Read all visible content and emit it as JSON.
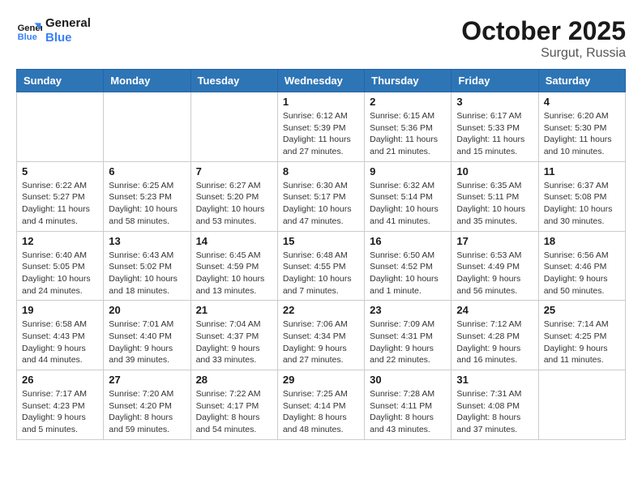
{
  "header": {
    "logo_general": "General",
    "logo_blue": "Blue",
    "month": "October 2025",
    "location": "Surgut, Russia"
  },
  "weekdays": [
    "Sunday",
    "Monday",
    "Tuesday",
    "Wednesday",
    "Thursday",
    "Friday",
    "Saturday"
  ],
  "weeks": [
    [
      {
        "day": "",
        "info": ""
      },
      {
        "day": "",
        "info": ""
      },
      {
        "day": "",
        "info": ""
      },
      {
        "day": "1",
        "info": "Sunrise: 6:12 AM\nSunset: 5:39 PM\nDaylight: 11 hours\nand 27 minutes."
      },
      {
        "day": "2",
        "info": "Sunrise: 6:15 AM\nSunset: 5:36 PM\nDaylight: 11 hours\nand 21 minutes."
      },
      {
        "day": "3",
        "info": "Sunrise: 6:17 AM\nSunset: 5:33 PM\nDaylight: 11 hours\nand 15 minutes."
      },
      {
        "day": "4",
        "info": "Sunrise: 6:20 AM\nSunset: 5:30 PM\nDaylight: 11 hours\nand 10 minutes."
      }
    ],
    [
      {
        "day": "5",
        "info": "Sunrise: 6:22 AM\nSunset: 5:27 PM\nDaylight: 11 hours\nand 4 minutes."
      },
      {
        "day": "6",
        "info": "Sunrise: 6:25 AM\nSunset: 5:23 PM\nDaylight: 10 hours\nand 58 minutes."
      },
      {
        "day": "7",
        "info": "Sunrise: 6:27 AM\nSunset: 5:20 PM\nDaylight: 10 hours\nand 53 minutes."
      },
      {
        "day": "8",
        "info": "Sunrise: 6:30 AM\nSunset: 5:17 PM\nDaylight: 10 hours\nand 47 minutes."
      },
      {
        "day": "9",
        "info": "Sunrise: 6:32 AM\nSunset: 5:14 PM\nDaylight: 10 hours\nand 41 minutes."
      },
      {
        "day": "10",
        "info": "Sunrise: 6:35 AM\nSunset: 5:11 PM\nDaylight: 10 hours\nand 35 minutes."
      },
      {
        "day": "11",
        "info": "Sunrise: 6:37 AM\nSunset: 5:08 PM\nDaylight: 10 hours\nand 30 minutes."
      }
    ],
    [
      {
        "day": "12",
        "info": "Sunrise: 6:40 AM\nSunset: 5:05 PM\nDaylight: 10 hours\nand 24 minutes."
      },
      {
        "day": "13",
        "info": "Sunrise: 6:43 AM\nSunset: 5:02 PM\nDaylight: 10 hours\nand 18 minutes."
      },
      {
        "day": "14",
        "info": "Sunrise: 6:45 AM\nSunset: 4:59 PM\nDaylight: 10 hours\nand 13 minutes."
      },
      {
        "day": "15",
        "info": "Sunrise: 6:48 AM\nSunset: 4:55 PM\nDaylight: 10 hours\nand 7 minutes."
      },
      {
        "day": "16",
        "info": "Sunrise: 6:50 AM\nSunset: 4:52 PM\nDaylight: 10 hours\nand 1 minute."
      },
      {
        "day": "17",
        "info": "Sunrise: 6:53 AM\nSunset: 4:49 PM\nDaylight: 9 hours\nand 56 minutes."
      },
      {
        "day": "18",
        "info": "Sunrise: 6:56 AM\nSunset: 4:46 PM\nDaylight: 9 hours\nand 50 minutes."
      }
    ],
    [
      {
        "day": "19",
        "info": "Sunrise: 6:58 AM\nSunset: 4:43 PM\nDaylight: 9 hours\nand 44 minutes."
      },
      {
        "day": "20",
        "info": "Sunrise: 7:01 AM\nSunset: 4:40 PM\nDaylight: 9 hours\nand 39 minutes."
      },
      {
        "day": "21",
        "info": "Sunrise: 7:04 AM\nSunset: 4:37 PM\nDaylight: 9 hours\nand 33 minutes."
      },
      {
        "day": "22",
        "info": "Sunrise: 7:06 AM\nSunset: 4:34 PM\nDaylight: 9 hours\nand 27 minutes."
      },
      {
        "day": "23",
        "info": "Sunrise: 7:09 AM\nSunset: 4:31 PM\nDaylight: 9 hours\nand 22 minutes."
      },
      {
        "day": "24",
        "info": "Sunrise: 7:12 AM\nSunset: 4:28 PM\nDaylight: 9 hours\nand 16 minutes."
      },
      {
        "day": "25",
        "info": "Sunrise: 7:14 AM\nSunset: 4:25 PM\nDaylight: 9 hours\nand 11 minutes."
      }
    ],
    [
      {
        "day": "26",
        "info": "Sunrise: 7:17 AM\nSunset: 4:23 PM\nDaylight: 9 hours\nand 5 minutes."
      },
      {
        "day": "27",
        "info": "Sunrise: 7:20 AM\nSunset: 4:20 PM\nDaylight: 8 hours\nand 59 minutes."
      },
      {
        "day": "28",
        "info": "Sunrise: 7:22 AM\nSunset: 4:17 PM\nDaylight: 8 hours\nand 54 minutes."
      },
      {
        "day": "29",
        "info": "Sunrise: 7:25 AM\nSunset: 4:14 PM\nDaylight: 8 hours\nand 48 minutes."
      },
      {
        "day": "30",
        "info": "Sunrise: 7:28 AM\nSunset: 4:11 PM\nDaylight: 8 hours\nand 43 minutes."
      },
      {
        "day": "31",
        "info": "Sunrise: 7:31 AM\nSunset: 4:08 PM\nDaylight: 8 hours\nand 37 minutes."
      },
      {
        "day": "",
        "info": ""
      }
    ]
  ]
}
